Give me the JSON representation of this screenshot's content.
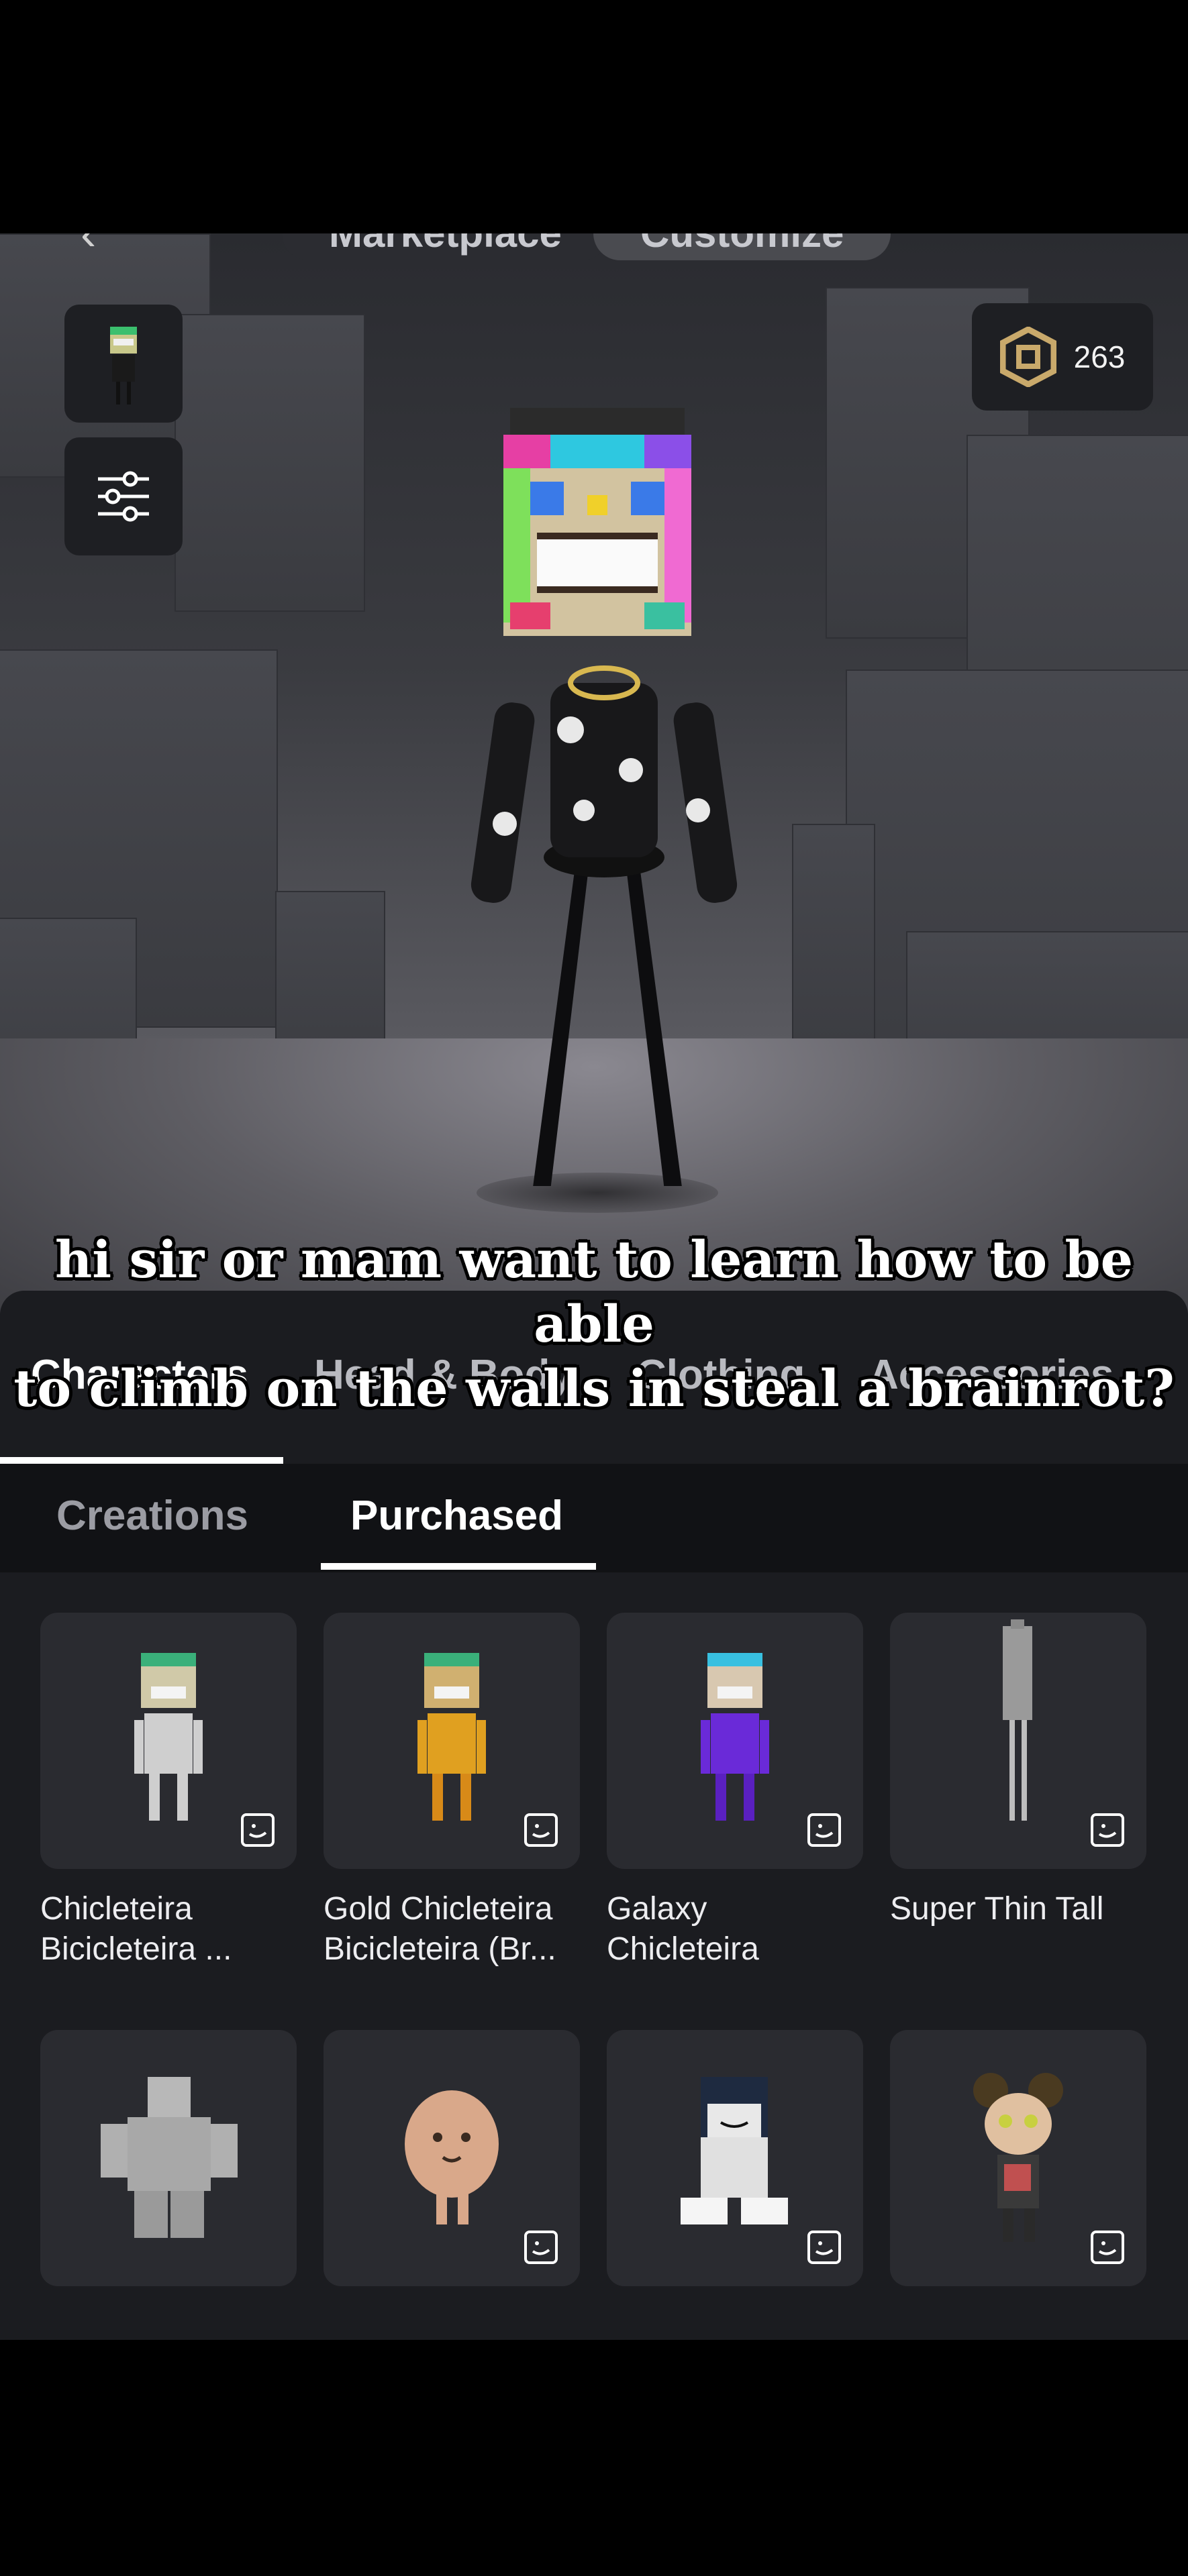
{
  "header": {
    "tabs": [
      {
        "label": "Marketplace"
      },
      {
        "label": "Customize"
      }
    ]
  },
  "robux": {
    "amount": "263",
    "icon": "robux-icon"
  },
  "subtitle": {
    "line1": "hi sir or mam want to learn how to be able",
    "line2": "to climb on the walls in steal a brainrot?"
  },
  "category_tabs": [
    {
      "label": "Characters",
      "active": true
    },
    {
      "label": "Head & Body",
      "active": false
    },
    {
      "label": "Clothing",
      "active": false
    },
    {
      "label": "Accessories",
      "active": false
    }
  ],
  "sub_tabs": [
    {
      "label": "Creations",
      "active": false
    },
    {
      "label": "Purchased",
      "active": true
    }
  ],
  "items": [
    {
      "title": "Chicleteira\nBicicleteira ..."
    },
    {
      "title": "Gold Chicleteira\nBicicleteira (Br..."
    },
    {
      "title": "Galaxy\nChicleteira"
    },
    {
      "title": "Super Thin Tall"
    },
    {
      "title": ""
    },
    {
      "title": ""
    },
    {
      "title": ""
    },
    {
      "title": ""
    }
  ],
  "colors": {
    "accent": "#ffffff",
    "panel": "#1b1c20",
    "card": "#2a2b30"
  }
}
